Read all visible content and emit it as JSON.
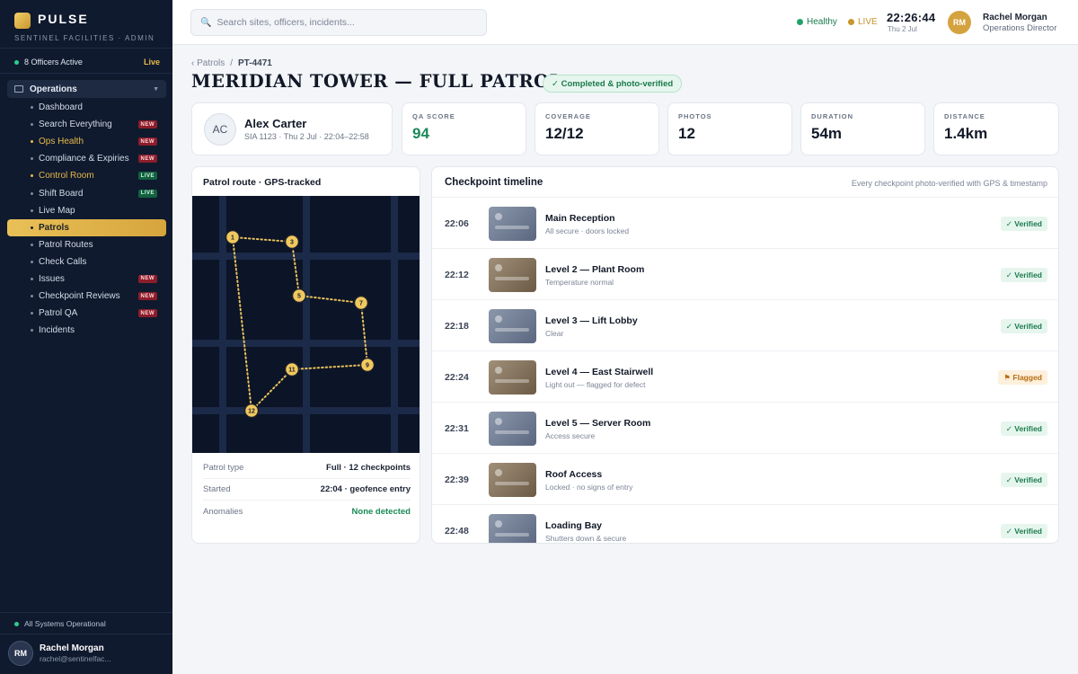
{
  "brand": {
    "name": "PULSE",
    "subtitle": "SENTINEL FACILITIES · ADMIN"
  },
  "sidebar": {
    "officers_active": "8 Officers Active",
    "live_label": "Live",
    "section": "Operations",
    "items": [
      {
        "label": "Dashboard",
        "tag": "",
        "style": ""
      },
      {
        "label": "Search Everything",
        "tag": "NEW",
        "style": ""
      },
      {
        "label": "Ops Health",
        "tag": "NEW",
        "style": "gold"
      },
      {
        "label": "Compliance & Expiries",
        "tag": "NEW",
        "style": ""
      },
      {
        "label": "Control Room",
        "tag": "LIVE",
        "style": "gold"
      },
      {
        "label": "Shift Board",
        "tag": "LIVE",
        "style": ""
      },
      {
        "label": "Live Map",
        "tag": "",
        "style": ""
      },
      {
        "label": "Patrols",
        "tag": "",
        "style": "active"
      },
      {
        "label": "Patrol Routes",
        "tag": "",
        "style": ""
      },
      {
        "label": "Check Calls",
        "tag": "",
        "style": ""
      },
      {
        "label": "Issues",
        "tag": "NEW",
        "style": ""
      },
      {
        "label": "Checkpoint Reviews",
        "tag": "NEW",
        "style": ""
      },
      {
        "label": "Patrol QA",
        "tag": "NEW",
        "style": ""
      },
      {
        "label": "Incidents",
        "tag": "",
        "style": ""
      }
    ],
    "system_status": "All Systems Operational",
    "user": {
      "initials": "RM",
      "name": "Rachel Morgan",
      "email": "rachel@sentinelfac..."
    }
  },
  "header": {
    "search_placeholder": "Search sites, officers, incidents...",
    "health": "Healthy",
    "live": "LIVE",
    "time": "22:26:44",
    "date": "Thu 2 Jul",
    "user": {
      "initials": "RM",
      "name": "Rachel Morgan",
      "role": "Operations Director"
    }
  },
  "colors": {
    "accent": "#d4a33f",
    "success": "#1a8a57",
    "warning": "#b86c12",
    "sidebar_bg": "#0f1a2e"
  },
  "breadcrumb": {
    "parent": "‹ Patrols",
    "separator": "/",
    "current": "PT-4471"
  },
  "page": {
    "title": "MERIDIAN TOWER — FULL PATROL",
    "status": "✓ Completed & photo-verified"
  },
  "officer": {
    "initials": "AC",
    "name": "Alex Carter",
    "meta": "SIA 1123 · Thu 2 Jul · 22:04–22:58"
  },
  "stats": [
    {
      "label": "QA SCORE",
      "value": "94",
      "highlight": true
    },
    {
      "label": "COVERAGE",
      "value": "12/12",
      "highlight": false
    },
    {
      "label": "PHOTOS",
      "value": "12",
      "highlight": false
    },
    {
      "label": "DURATION",
      "value": "54m",
      "highlight": false
    },
    {
      "label": "DISTANCE",
      "value": "1.4km",
      "highlight": false
    }
  ],
  "route": {
    "title": "Patrol route · GPS-tracked",
    "checkpoints": [
      {
        "label": "1"
      },
      {
        "label": "3"
      },
      {
        "label": "5"
      },
      {
        "label": "7"
      },
      {
        "label": "9"
      },
      {
        "label": "11"
      },
      {
        "label": "12"
      }
    ],
    "info": [
      {
        "key": "Patrol type",
        "value": "Full · 12 checkpoints",
        "green": false
      },
      {
        "key": "Started",
        "value": "22:04 · geofence entry",
        "green": false
      },
      {
        "key": "Anomalies",
        "value": "None detected",
        "green": true
      }
    ]
  },
  "timeline": {
    "title": "Checkpoint timeline",
    "subtitle": "Every checkpoint photo-verified with GPS & timestamp",
    "rows": [
      {
        "time": "22:06",
        "name": "Main Reception",
        "note": "All secure · doors locked",
        "status": "✓ Verified",
        "status_type": "ok",
        "photo": "slate"
      },
      {
        "time": "22:12",
        "name": "Level 2 — Plant Room",
        "note": "Temperature normal",
        "status": "✓ Verified",
        "status_type": "ok",
        "photo": "sepia"
      },
      {
        "time": "22:18",
        "name": "Level 3 — Lift Lobby",
        "note": "Clear",
        "status": "✓ Verified",
        "status_type": "ok",
        "photo": "slate"
      },
      {
        "time": "22:24",
        "name": "Level 4 — East Stairwell",
        "note": "Light out — flagged for defect",
        "status": "⚑ Flagged",
        "status_type": "flag",
        "photo": "sepia"
      },
      {
        "time": "22:31",
        "name": "Level 5 — Server Room",
        "note": "Access secure",
        "status": "✓ Verified",
        "status_type": "ok",
        "photo": "slate"
      },
      {
        "time": "22:39",
        "name": "Roof Access",
        "note": "Locked · no signs of entry",
        "status": "✓ Verified",
        "status_type": "ok",
        "photo": "sepia"
      },
      {
        "time": "22:48",
        "name": "Loading Bay",
        "note": "Shutters down & secure",
        "status": "✓ Verified",
        "status_type": "ok",
        "photo": "slate"
      }
    ]
  }
}
